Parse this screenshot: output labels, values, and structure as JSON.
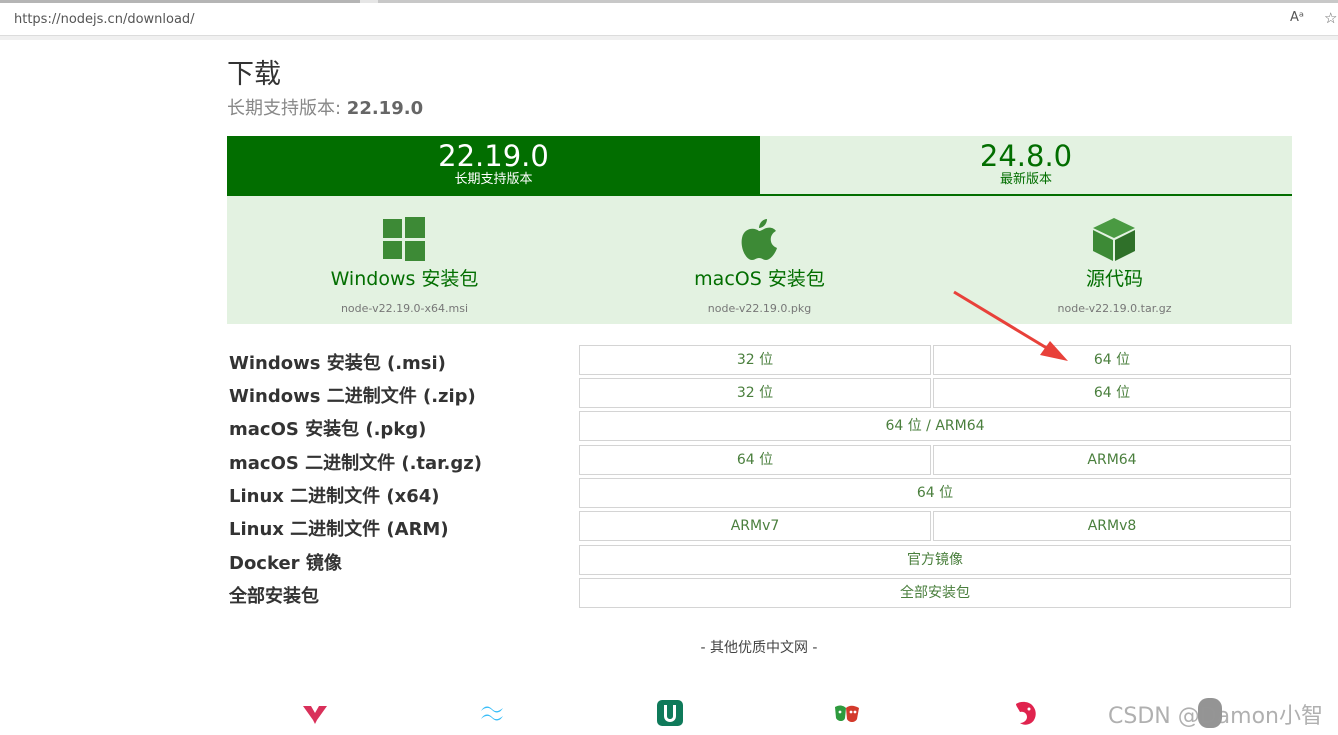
{
  "browser": {
    "url": "https://nodejs.cn/download/",
    "read_aloud_label": "Aᵃ",
    "favorite_glyph": "☆"
  },
  "header": {
    "title": "下载",
    "subtitle_prefix": "长期支持版本: ",
    "subtitle_version": "22.19.0"
  },
  "tabs": [
    {
      "version": "22.19.0",
      "label": "长期支持版本"
    },
    {
      "version": "24.8.0",
      "label": "最新版本"
    }
  ],
  "downloads": [
    {
      "name": "Windows 安装包",
      "file": "node-v22.19.0-x64.msi",
      "icon": "windows-icon"
    },
    {
      "name": "macOS 安装包",
      "file": "node-v22.19.0.pkg",
      "icon": "apple-icon"
    },
    {
      "name": "源代码",
      "file": "node-v22.19.0.tar.gz",
      "icon": "box-icon"
    }
  ],
  "table": [
    {
      "label": "Windows 安装包 (.msi)",
      "cells": [
        "32 位",
        "64 位"
      ]
    },
    {
      "label": "Windows 二进制文件 (.zip)",
      "cells": [
        "32 位",
        "64 位"
      ]
    },
    {
      "label": "macOS 安装包 (.pkg)",
      "cells": [
        "64 位 / ARM64"
      ]
    },
    {
      "label": "macOS 二进制文件 (.tar.gz)",
      "cells": [
        "64 位",
        "ARM64"
      ]
    },
    {
      "label": "Linux 二进制文件 (x64)",
      "cells": [
        "64 位"
      ]
    },
    {
      "label": "Linux 二进制文件 (ARM)",
      "cells": [
        "ARMv7",
        "ARMv8"
      ]
    },
    {
      "label": "Docker 镜像",
      "cells": [
        "官方镜像"
      ]
    },
    {
      "label": "全部安装包",
      "cells": [
        "全部安装包"
      ]
    }
  ],
  "others_heading": "- 其他优质中文网 -",
  "watermark": "CSDN @Damon小智",
  "colors": {
    "brand_green": "#026e00",
    "light_green": "#e3f2e1",
    "link_green": "#4a7f3d",
    "arrow_red": "#e8413a"
  }
}
